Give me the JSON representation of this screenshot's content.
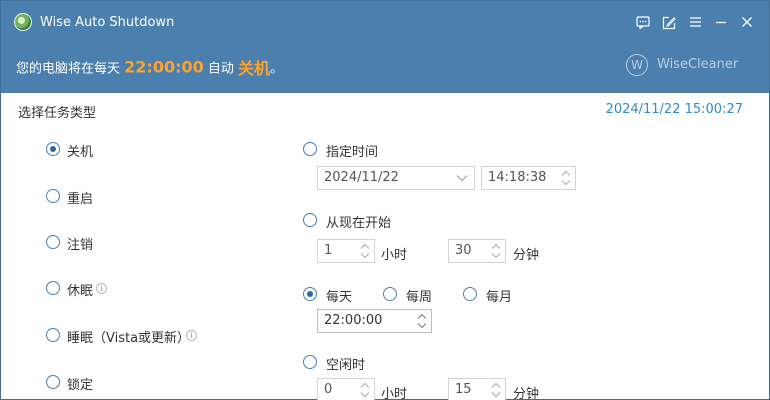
{
  "window": {
    "title": "Wise Auto Shutdown",
    "accent_color": "#4a7fae",
    "highlight_color": "#ffa22b"
  },
  "titlebar_icons": [
    "chat-icon",
    "edit-icon",
    "menu-icon",
    "minimize-icon",
    "close-icon"
  ],
  "banner": {
    "prefix": "您的电脑将在每天",
    "time": "22:00:00",
    "middle": "自动",
    "action": "关机",
    "suffix": "。",
    "brand_mark": "W",
    "brand_name": "WiseCleaner"
  },
  "task": {
    "section_label": "选择任务类型",
    "current_datetime": "2024/11/22 15:00:27",
    "types": [
      {
        "label": "关机",
        "checked": true
      },
      {
        "label": "重启",
        "checked": false
      },
      {
        "label": "注销",
        "checked": false
      },
      {
        "label": "休眠",
        "checked": false,
        "info": true
      },
      {
        "label": "睡眠（Vista或更新）",
        "checked": false,
        "info": true
      },
      {
        "label": "锁定",
        "checked": false
      }
    ]
  },
  "schedule": {
    "specified": {
      "label": "指定时间",
      "checked": false,
      "date": "2024/11/22",
      "time": "14:18:38"
    },
    "from_now": {
      "label": "从现在开始",
      "checked": false,
      "hours": "1",
      "hours_unit": "小时",
      "minutes": "30",
      "minutes_unit": "分钟"
    },
    "daily": {
      "label": "每天",
      "checked": true,
      "time": "22:00:00"
    },
    "weekly": {
      "label": "每周",
      "checked": false
    },
    "monthly": {
      "label": "每月",
      "checked": false
    },
    "idle": {
      "label": "空闲时",
      "checked": false,
      "hours": "0",
      "hours_unit": "小时",
      "minutes": "15",
      "minutes_unit": "分钟"
    }
  }
}
